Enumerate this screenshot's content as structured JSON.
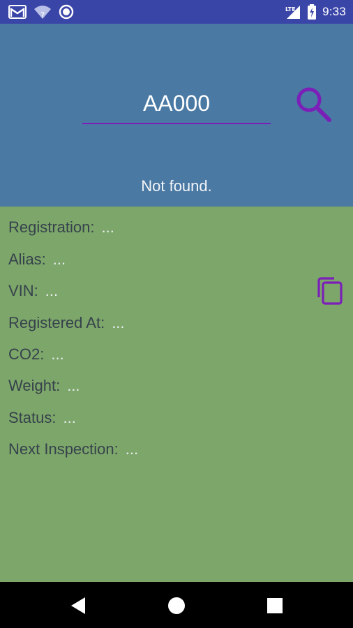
{
  "status_bar": {
    "time": "9:33",
    "icons": [
      "gmail-icon",
      "wifi-icon",
      "sync-icon",
      "lte-signal-icon",
      "battery-charging-icon"
    ]
  },
  "search": {
    "value": "AA000",
    "placeholder": ""
  },
  "result": {
    "message": "Not found."
  },
  "details": {
    "fields": [
      {
        "label": "Registration:",
        "value": "..."
      },
      {
        "label": "Alias:",
        "value": "..."
      },
      {
        "label": "VIN:",
        "value": "..."
      },
      {
        "label": "Registered At:",
        "value": "..."
      },
      {
        "label": "CO2:",
        "value": "..."
      },
      {
        "label": "Weight:",
        "value": "..."
      },
      {
        "label": "Status:",
        "value": "..."
      },
      {
        "label": "Next Inspection:",
        "value": "..."
      }
    ]
  },
  "colors": {
    "status_bar": "#3a45a8",
    "header": "#4a79a3",
    "details": "#7da66a",
    "accent": "#7b1fb8"
  }
}
